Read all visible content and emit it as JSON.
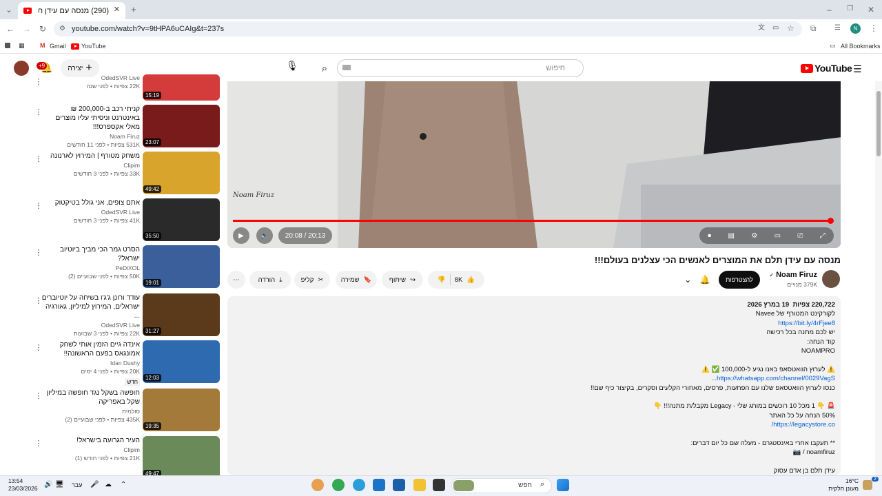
{
  "browser": {
    "tab_title": "(290) מנסה עם עידן תלם את הכ",
    "url": "youtube.com/watch?v=9tHPA6uCAIg&t=237s",
    "bookmarks": {
      "gmail": "Gmail",
      "youtube": "YouTube",
      "all_bookmarks": "All Bookmarks"
    },
    "profile_initial": "N"
  },
  "header": {
    "search_placeholder": "חיפוש",
    "create_label": "יצירה",
    "notifications_badge": "+9",
    "logo_text": "YouTube"
  },
  "sidebar": {
    "items": [
      {
        "title": "",
        "channel": "OdedSVR Live",
        "meta": "22K צפיות • לפני שנה",
        "duration": "15:19"
      },
      {
        "title": "קניתי רכב ב-200,000 ₪ באינטרנט וניסיתי עליו מוצרים מאלי אקספרס!!!",
        "channel": "Noam Firuz",
        "meta": "531K צפיות • לפני 11 חודשים",
        "duration": "23:07"
      },
      {
        "title": "משחק מטורף | המירוץ לארנונה",
        "channel": "Clipim",
        "meta": "33K צפיות • לפני 3 חודשים",
        "duration": "49:42"
      },
      {
        "title": "אתם צופים, אני גולל בטיקטוק",
        "channel": "OdedSVR Live",
        "meta": "41K צפיות • לפני 3 חודשים",
        "duration": "35:50"
      },
      {
        "title": "הסרט גמר הכי מביך ביוטיוב ישראל?",
        "channel": "PeDiXOL",
        "meta": "50K צפיות • לפני שבועיים (2)",
        "duration": "19:01"
      },
      {
        "title": "עודד ורונן ג'ג'ו בשיחה על יוטיוברים ישראלים, המירוץ למיליון, גאורגיה ...",
        "channel": "OdedSVR Live",
        "meta": "22K צפיות • לפני 3 שבועות",
        "duration": "31:27"
      },
      {
        "title": "אינדה גיים הזמין אותי לשחק אמונגאס בפעם הראשונה!!",
        "channel": "Idan Dushy",
        "meta": "20K צפיות • לפני 4 ימים",
        "duration": "12:03",
        "badge": "חדש"
      },
      {
        "title": "חופשה בשקל נגד חופשה במיליון שקל באפריקה",
        "channel": "סולמית",
        "meta": "435K צפיות • לפני שבועיים (2)",
        "duration": "19:35"
      },
      {
        "title": "העיר הגרועה בישראל!",
        "channel": "Clipim",
        "meta": "21K צפיות • לפני חודש (1)",
        "duration": "49:47"
      }
    ]
  },
  "player": {
    "time_current": "20:08",
    "time_total": "20:13",
    "time_separator": "/",
    "progress": 0.996,
    "watermark": "Noam Firuz"
  },
  "video": {
    "title": "מנסה עם עידן תלם את המוצרים לאנשים הכי עצלנים בעולם!!!",
    "channel_name": "Noam Firuz",
    "subscribers": "379K מנויים",
    "subscribe_label": "להצטרפות",
    "likes": "8K",
    "share_label": "שיתוף",
    "save_label": "שמירה",
    "clip_label": "קליפ",
    "download_label": "הורדה"
  },
  "description": {
    "views": "220,722 צפיות",
    "date": "19 במרץ 2026",
    "lines": [
      {
        "text": "לקורקינט המטורף של Navee",
        "link": false
      },
      {
        "text": "https://bit.ly/4rFjee8",
        "link": true
      },
      {
        "text": "יש לכם מתנה בכל רכישה",
        "link": false
      },
      {
        "text": "קוד הנחה:",
        "link": false
      },
      {
        "text": "NOAMPRO",
        "link": false
      },
      {
        "text": "",
        "link": false
      },
      {
        "text": "⚠️ לערוץ הוואטסאפ באנו נגיע ל-100,000 ✅ ⚠️",
        "link": false
      },
      {
        "text": "https://whatsapp.com/channel/0029VagS...",
        "link": true
      },
      {
        "text": "כנסו לערוץ הוואטסאפ שלנו עם הפתעות, פרסים, מאחורי הקלעים וסקרים, בקיצור כיף שם!!",
        "link": false
      },
      {
        "text": "",
        "link": false
      },
      {
        "text": "🚨 👇 1 מכל 10 רוכשים במותג שלי - Legacy מקבל/ת מתנה!!! 👇",
        "link": false
      },
      {
        "text": "50% הנחה על כל האתר",
        "link": false
      },
      {
        "text": "https://legacystore.co/",
        "link": true
      },
      {
        "text": "",
        "link": false
      },
      {
        "text": "** תעקבו אחרי באינסטגרם - מעלה שם כל יום דברים:",
        "link": false
      },
      {
        "text": "noamfiruz / 📷",
        "link": false
      },
      {
        "text": "",
        "link": false
      },
      {
        "text": "עידן תלם בן אדם עסוק",
        "link": false
      }
    ]
  },
  "taskbar": {
    "time": "13:54",
    "date": "23/03/2026",
    "lang": "עבר",
    "search_placeholder": "חפש",
    "temperature": "16°C",
    "weather_desc": "מעונן חלקית",
    "notif_count": "2"
  }
}
